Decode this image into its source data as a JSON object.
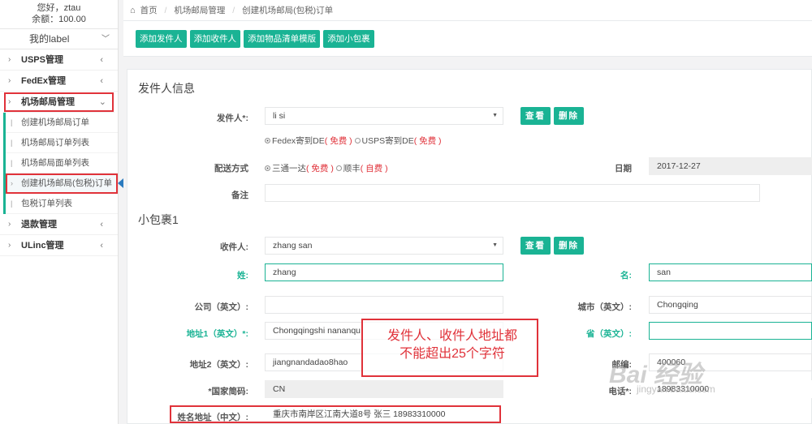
{
  "user": {
    "greeting": "您好，ztau",
    "balance": "余额：100.00"
  },
  "sidebar": {
    "mylabel": "我的label",
    "menus": [
      {
        "label": "USPS管理",
        "arrow": "‹"
      },
      {
        "label": "FedEx管理",
        "arrow": "‹"
      },
      {
        "label": "机场邮局管理",
        "arrow": "⌄"
      },
      {
        "label": "退款管理",
        "arrow": "‹"
      },
      {
        "label": "ULinc管理",
        "arrow": "‹"
      }
    ],
    "submenu": [
      "创建机场邮局订单",
      "机场邮局订单列表",
      "机场邮局面单列表",
      "创建机场邮局(包税)订单",
      "包税订单列表"
    ]
  },
  "breadcrumb": {
    "home": "首页",
    "level1": "机场邮局管理",
    "level2": "创建机场邮局(包税)订单"
  },
  "toolbar": {
    "buttons": [
      "添加发件人",
      "添加收件人",
      "添加物品清单模版",
      "添加小包裹"
    ]
  },
  "sender_section": {
    "title": "发件人信息",
    "sender_label": "发件人*:",
    "sender_value": "li si",
    "view_btn": "查看",
    "delete_btn": "删除",
    "route_opt1": "Fedex寄到DE",
    "route_opt1_fee": "( 免费 )",
    "route_opt2": "USPS寄到DE",
    "route_opt2_fee": "( 免费 )",
    "delivery_label": "配送方式",
    "delivery_opt1": "三通一达",
    "delivery_opt1_fee": "( 免费 )",
    "delivery_opt2": "顺丰",
    "delivery_opt2_fee": "( 自费 )",
    "date_label": "日期",
    "date_value": "2017-12-27",
    "remark_label": "备注",
    "remark_value": ""
  },
  "package_section": {
    "title": "小包裹1",
    "recipient_label": "收件人:",
    "recipient_value": "zhang san",
    "view_btn": "查看",
    "delete_btn": "删除",
    "surname_label": "姓:",
    "surname_value": "zhang",
    "given_label": "名:",
    "given_value": "san",
    "company_label": "公司（英文）:",
    "company_value": "",
    "city_label": "城市（英文）:",
    "city_value": "Chongqing",
    "addr1_label": "地址1（英文）*:",
    "addr1_value": "Chongqingshi nananqu",
    "province_label": "省（英文）:",
    "province_value": "",
    "addr2_label": "地址2（英文）:",
    "addr2_value": "jiangnandadao8hao",
    "zip_label": "邮编:",
    "zip_value": "400060",
    "country_label": "*国家简码:",
    "country_value": "CN",
    "phone_label": "电话*:",
    "phone_value": "18983310000",
    "cn_addr_label": "姓名地址（中文）:",
    "cn_addr_value": "重庆市南岸区江南大道8号 张三 18983310000"
  },
  "annotation": {
    "line1": "发件人、收件人地址都",
    "line2": "不能超出25个字符"
  },
  "watermark": {
    "main": "Bai 经验",
    "sub": "jingyan.baidu.com"
  },
  "colors": {
    "accent": "#1ab394",
    "highlight": "#e0323a",
    "fee_red": "#e0323a"
  }
}
